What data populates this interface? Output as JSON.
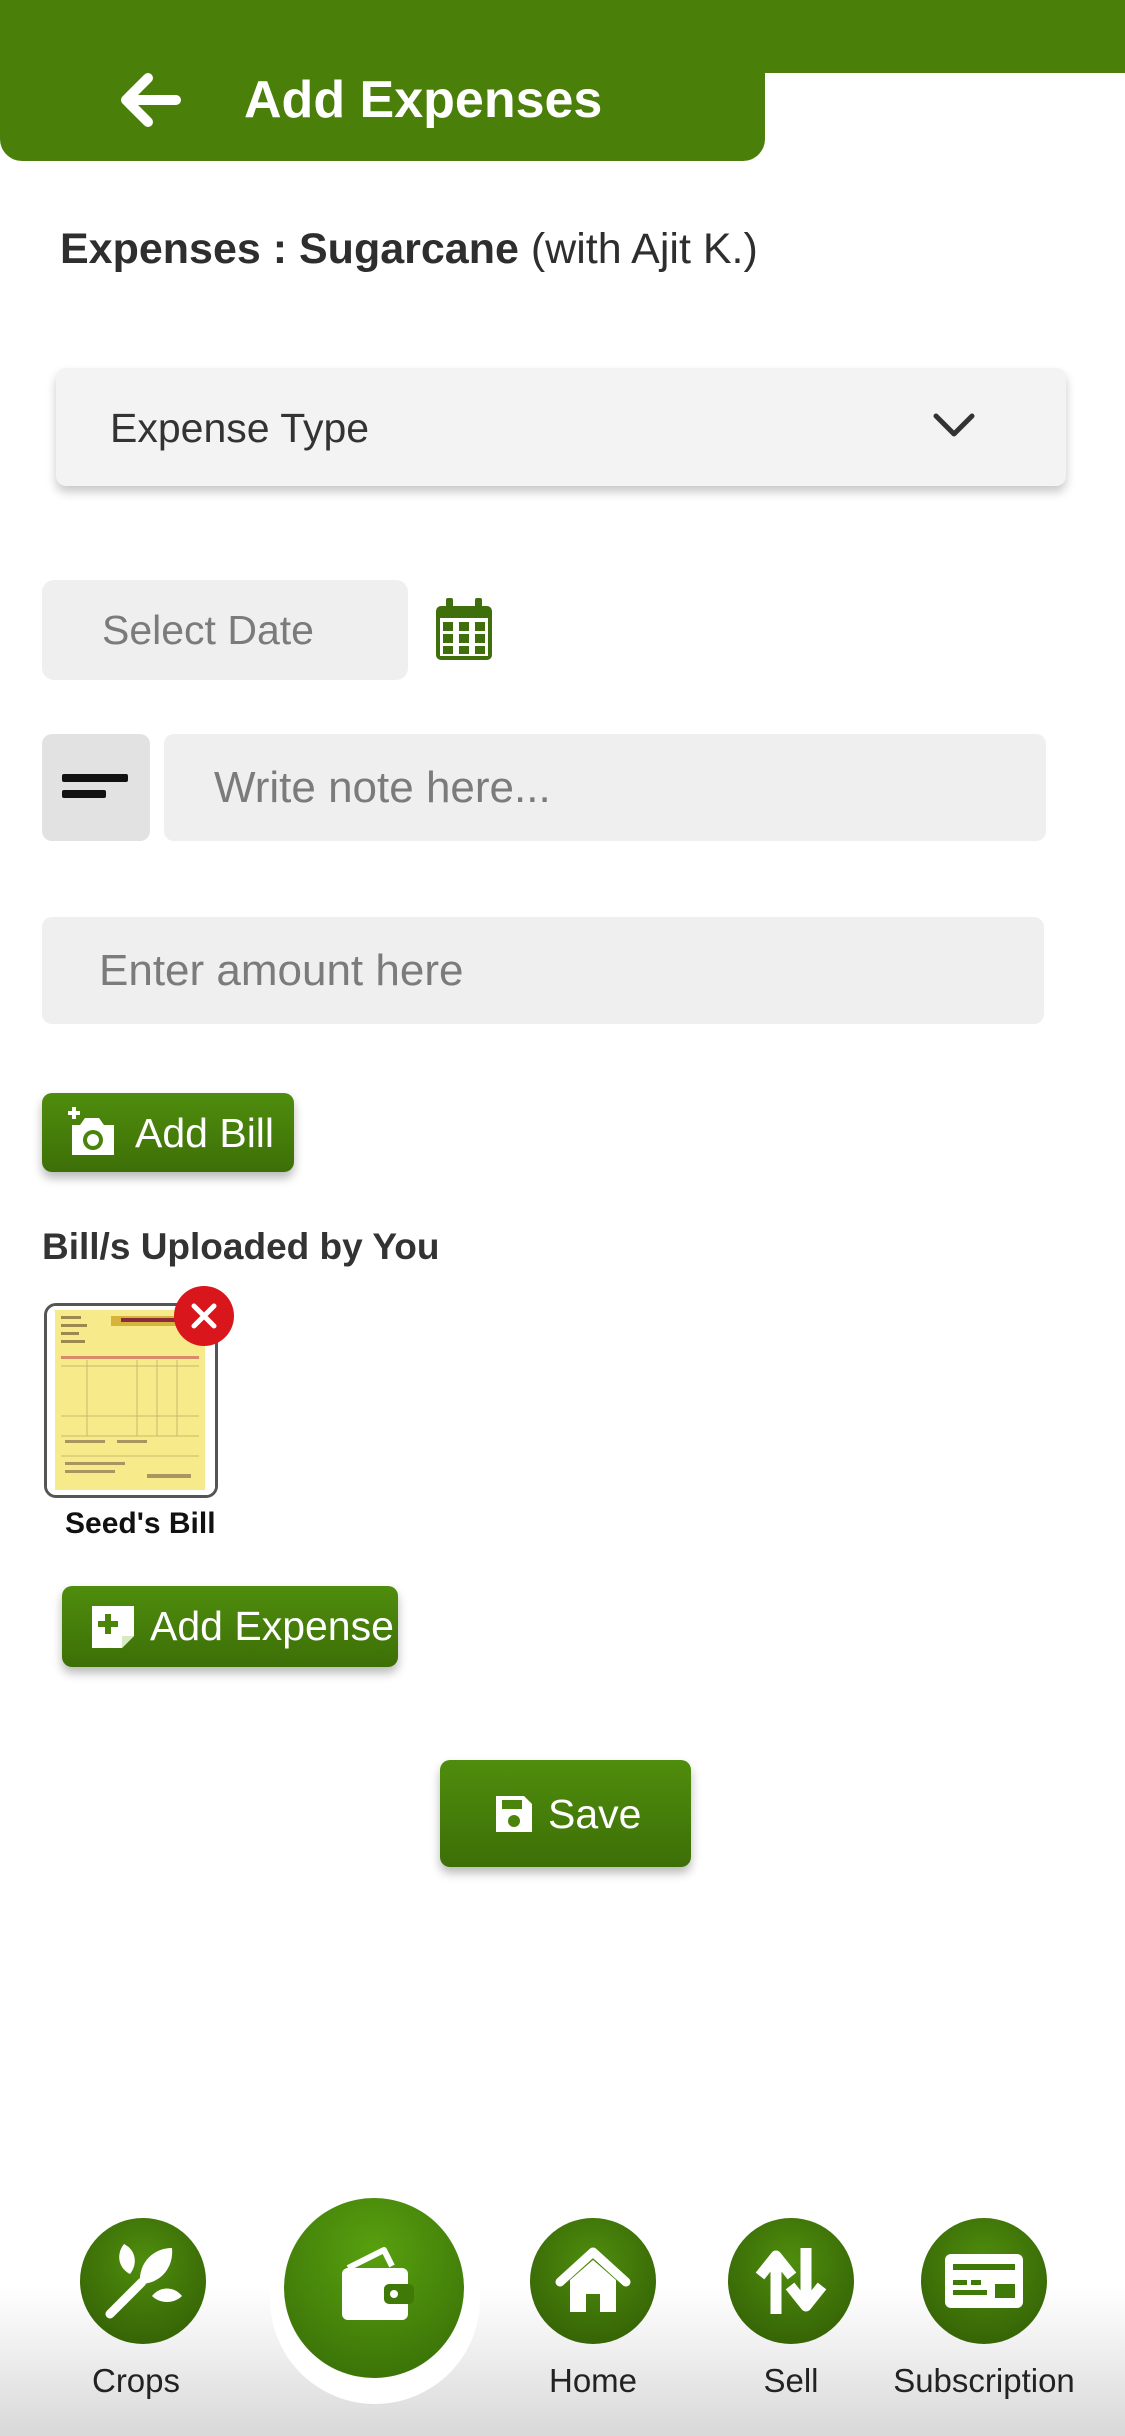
{
  "header": {
    "title": "Add Expenses",
    "back_icon": "arrow-left-icon"
  },
  "subtitle": {
    "prefix": "Expenses : ",
    "crop": "Sugarcane",
    "partner": " (with Ajit K.)"
  },
  "form": {
    "expense_type_placeholder": "Expense Type",
    "date_placeholder": "Select Date",
    "note_placeholder": "Write note here...",
    "amount_placeholder": "Enter amount here"
  },
  "buttons": {
    "add_bill": "Add Bill",
    "add_expense": "Add Expense",
    "save": "Save"
  },
  "bills": {
    "heading": "Bill/s Uploaded by You",
    "items": [
      {
        "caption": "Seed's Bill"
      }
    ]
  },
  "nav": {
    "items": [
      {
        "label": "Crops",
        "icon": "sprout-icon"
      },
      {
        "label": "",
        "icon": "wallet-icon"
      },
      {
        "label": "Home",
        "icon": "home-icon"
      },
      {
        "label": "Sell",
        "icon": "sort-arrows-icon"
      },
      {
        "label": "Subscription",
        "icon": "card-icon"
      }
    ]
  },
  "colors": {
    "primary_green": "#4a7f0a",
    "remove_red": "#d8161c"
  }
}
